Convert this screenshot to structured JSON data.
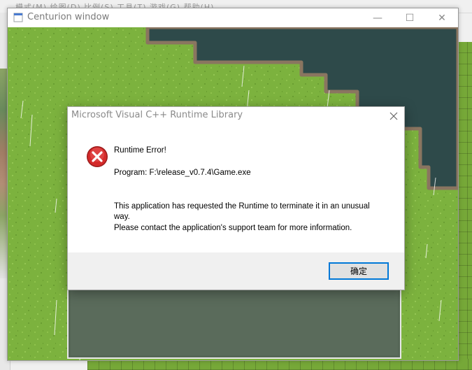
{
  "background_app": {
    "menu_text": "模式(M)  绘图(D)  比例(S)  工具(T)  游戏(G)  帮助(H)"
  },
  "game_window": {
    "title": "Centurion window",
    "icon": "app-icon",
    "controls": {
      "minimize_glyph": "—",
      "maximize_glyph": "☐",
      "close_glyph": "✕"
    }
  },
  "dialog": {
    "title": "Microsoft Visual C++ Runtime Library",
    "icon": "error-icon",
    "heading": "Runtime Error!",
    "program": "Program: F:\\release_v0.7.4\\Game.exe",
    "message_line1": "This application has requested the Runtime to terminate it in an unusual",
    "message_line2": "way.",
    "message_line3": "Please contact the application's support team for more information.",
    "ok_label": "确定"
  },
  "colors": {
    "grass": "#7cb23e",
    "water": "#2e4a4a",
    "shore": "#8a7560",
    "error_red": "#d42a2a",
    "focus_blue": "#0078d7"
  }
}
